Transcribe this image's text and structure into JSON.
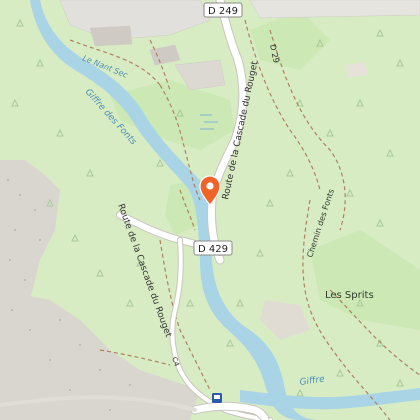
{
  "map": {
    "road_shields": {
      "top": "D 249",
      "middle": "D 429"
    },
    "labels": {
      "le_nant_sec": "Le Nant Sec",
      "giffre_des_fonts_river": "Giffre des Fonts",
      "route_cascade_rouget_upper": "Route de la Cascade du Rouget",
      "route_cascade_rouget_lower": "Route de la Cascade du Rouget",
      "d29": "D 29",
      "chemin_des_fonts": "Chemin des Fonts",
      "les_sprits": "Les Sprits",
      "giffre_lower": "Giffre",
      "c4": "C4"
    },
    "marker": {
      "icon": "location-pin-icon",
      "color": "#f0642a"
    },
    "colors": {
      "forest": "#d8ecc4",
      "meadow": "#c8e6b0",
      "water": "#a8d4e6",
      "road": "#ffffff",
      "rock": "#d9d6d0",
      "trail": "#b08060",
      "marker": "#f0642a"
    }
  }
}
